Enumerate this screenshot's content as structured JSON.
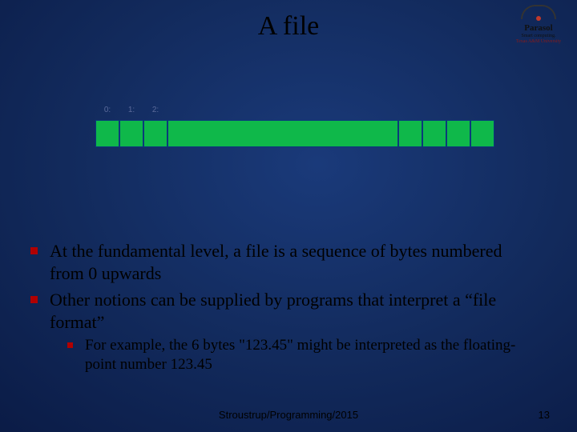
{
  "title": "A file",
  "logo": {
    "name": "Parasol",
    "tagline": "Smart computing.",
    "university": "Texas A&M University"
  },
  "byte_labels": [
    "0:",
    "1:",
    "2:"
  ],
  "bullets": {
    "b1": "At the fundamental level, a file is a sequence of bytes numbered from 0 upwards",
    "b2": "Other notions can be supplied by programs that interpret a “file format”",
    "b2_sub1": "For example, the 6 bytes \"123.45\" might be interpreted as the floating-point number 123.45"
  },
  "footer": "Stroustrup/Programming/2015",
  "page_number": "13"
}
